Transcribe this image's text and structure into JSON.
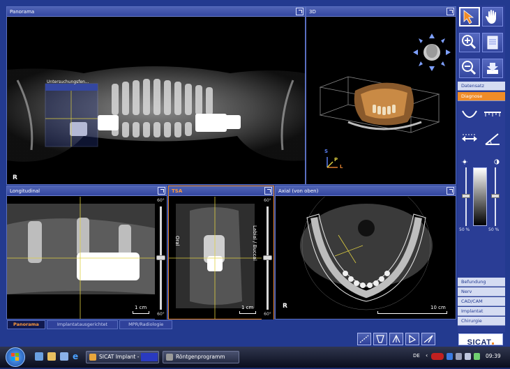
{
  "views": {
    "panorama": {
      "title": "Panorama",
      "orientation": "R",
      "overlay_title": "Untersuchungsfen..."
    },
    "view3d": {
      "title": "3D",
      "axis_s": "S",
      "axis_p": "P",
      "axis_l": "L"
    },
    "longitudinal": {
      "title": "Longitudinal",
      "scale": "1 cm",
      "slider_top": "60°",
      "slider_bottom": "60°"
    },
    "tsa": {
      "title": "TSA",
      "scale": "1 cm",
      "side_left": "Oral",
      "side_right": "Labial / Buccal",
      "slider_top": "60°",
      "slider_bottom": "60°"
    },
    "axial": {
      "title": "Axial (von oben)",
      "orientation": "R",
      "scale": "10 cm"
    }
  },
  "tabs": [
    {
      "label": "Panorama",
      "active": true
    },
    {
      "label": "Implantatausgerichtet",
      "active": false
    },
    {
      "label": "MPR/Radiologie",
      "active": false
    }
  ],
  "toolbar": {
    "tools": [
      "pointer-icon",
      "hand-icon",
      "zoom-in-icon",
      "notepad-icon",
      "zoom-out-icon",
      "download-icon"
    ],
    "menu_top": [
      {
        "label": "Datensatz",
        "active": false
      },
      {
        "label": "Diagnose",
        "active": true
      }
    ],
    "window_level": {
      "left_value": "50 %",
      "right_value": "50 %"
    },
    "menu_bottom": [
      {
        "label": "Befundung"
      },
      {
        "label": "Nerv"
      },
      {
        "label": "CAD/CAM"
      },
      {
        "label": "Implantat"
      },
      {
        "label": "Chirurgie"
      }
    ]
  },
  "bottom_tools": [
    "measure-icon",
    "implant-tool-1-icon",
    "implant-tool-2-icon",
    "implant-tool-3-icon",
    "implant-tool-4-icon"
  ],
  "brand": "SICAT",
  "taskbar": {
    "items": [
      {
        "label": "SICAT Implant -"
      },
      {
        "label": "Röntgenprogramm"
      }
    ],
    "language": "DE",
    "clock": "09:39"
  },
  "colors": {
    "accent": "#f08c28",
    "frame": "#233a8f",
    "crosshair": "#e0d040"
  }
}
